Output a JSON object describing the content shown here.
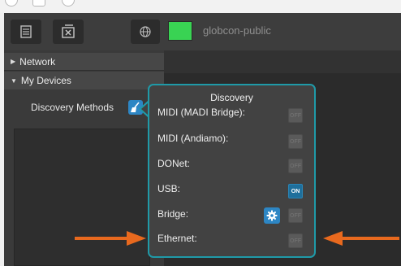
{
  "toolbar": {
    "network_name": "globcon-public",
    "status_color": "#39d353",
    "icons": [
      "device-list-icon",
      "close-window-icon",
      "globe-icon"
    ]
  },
  "sidebar": {
    "items": [
      {
        "label": "Network",
        "expanded": false
      },
      {
        "label": "My Devices",
        "expanded": true
      }
    ],
    "discovery_methods_label": "Discovery Methods"
  },
  "popover": {
    "title": "Discovery",
    "rows": [
      {
        "label": "MIDI (MADI Bridge):",
        "toggle": "off",
        "toggle_text": "OFF"
      },
      {
        "label": "MIDI (Andiamo):",
        "toggle": "off",
        "toggle_text": "OFF"
      },
      {
        "label": "DONet:",
        "toggle": "off",
        "toggle_text": "OFF"
      },
      {
        "label": "USB:",
        "toggle": "on",
        "toggle_text": "ON"
      },
      {
        "label": "Bridge:",
        "toggle": "off",
        "toggle_text": "OFF",
        "has_settings": true
      },
      {
        "label": "Ethernet:",
        "toggle": "off",
        "toggle_text": "OFF"
      }
    ]
  },
  "colors": {
    "accent": "#1f9aa8",
    "arrow": "#e8691e",
    "on_toggle": "#1e6f9c"
  }
}
